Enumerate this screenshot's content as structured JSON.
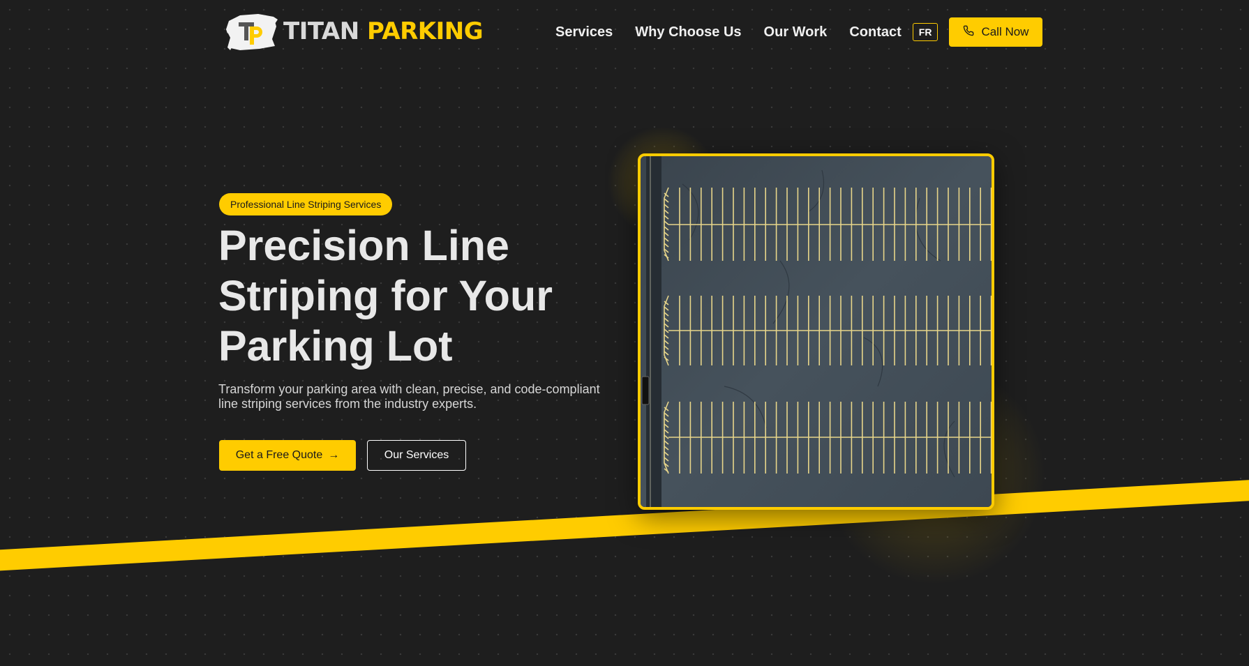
{
  "brand": {
    "name_part1": "TITAN",
    "name_part2": "PARKING",
    "accent_color": "#ffcc00",
    "background_color": "#1e1e1e"
  },
  "nav": {
    "items": [
      {
        "label": "Services"
      },
      {
        "label": "Why Choose Us"
      },
      {
        "label": "Our Work"
      },
      {
        "label": "Contact"
      }
    ],
    "lang_toggle": "FR",
    "call_button": {
      "label": "Call Now",
      "icon": "phone-icon"
    }
  },
  "hero": {
    "badge": "Professional Line Striping Services",
    "title": "Precision Line Striping for Your Parking Lot",
    "subtitle": "Transform your parking area with clean, precise, and code-compliant line striping services from the industry experts.",
    "primary_button": {
      "label": "Get a Free Quote",
      "icon": "arrow-right-icon"
    },
    "secondary_button": {
      "label": "Our Services"
    },
    "image": {
      "subject": "aerial-parking-lot"
    }
  }
}
